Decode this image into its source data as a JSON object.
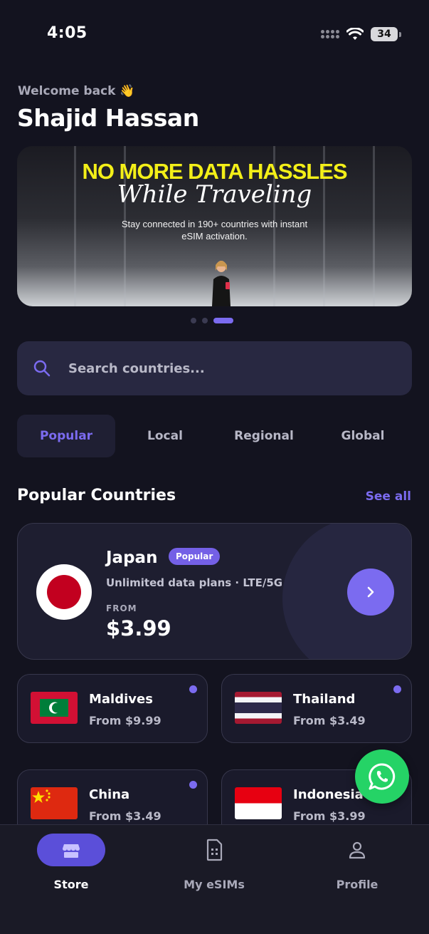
{
  "status_bar": {
    "time": "4:05",
    "battery": "34"
  },
  "header": {
    "welcome": "Welcome back 👋",
    "username": "Shajid Hassan"
  },
  "banner": {
    "headline": "NO MORE DATA HASSLES",
    "script_text": "While Traveling",
    "subtext": "Stay connected in 190+ countries with instant eSIM activation.",
    "active_slide": 3,
    "slide_count": 3
  },
  "search": {
    "placeholder": "Search countries...",
    "value": ""
  },
  "tabs": [
    {
      "label": "Popular",
      "active": true
    },
    {
      "label": "Local",
      "active": false
    },
    {
      "label": "Regional",
      "active": false
    },
    {
      "label": "Global",
      "active": false
    }
  ],
  "section": {
    "title": "Popular Countries",
    "see_all": "See all"
  },
  "featured": {
    "name": "Japan",
    "badge": "Popular",
    "description": "Unlimited data plans · LTE/5G",
    "from_label": "FROM",
    "price": "$3.99"
  },
  "countries": [
    {
      "name": "Maldives",
      "price": "From $9.99"
    },
    {
      "name": "Thailand",
      "price": "From $3.49"
    },
    {
      "name": "China",
      "price": "From $3.49"
    },
    {
      "name": "Indonesia",
      "price": "From $3.99"
    }
  ],
  "bottom_nav": [
    {
      "label": "Store",
      "icon": "store-icon",
      "active": true
    },
    {
      "label": "My eSIMs",
      "icon": "sim-card-icon",
      "active": false
    },
    {
      "label": "Profile",
      "icon": "user-icon",
      "active": false
    }
  ],
  "colors": {
    "accent": "#7b6bf0",
    "background": "#13131f",
    "whatsapp": "#25d366"
  }
}
